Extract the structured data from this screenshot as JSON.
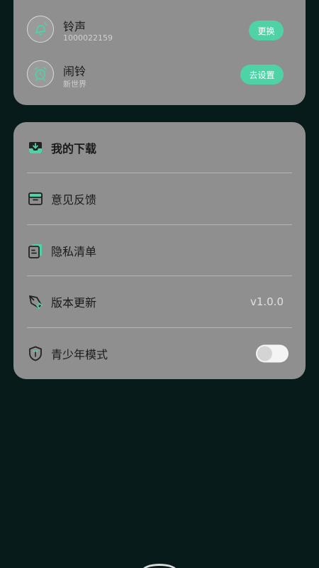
{
  "ringtones": [
    {
      "title": "铃声",
      "subtitle": "1000022159",
      "action": "更换",
      "icon": "bell-icon"
    },
    {
      "title": "闹铃",
      "subtitle": "新世界",
      "action": "去设置",
      "icon": "alarm-clock-icon"
    }
  ],
  "menu": [
    {
      "label": "我的下载",
      "icon": "download-inbox-icon"
    },
    {
      "label": "意见反馈",
      "icon": "feedback-box-icon"
    },
    {
      "label": "隐私清单",
      "icon": "document-list-icon"
    },
    {
      "label": "版本更新",
      "icon": "rocket-icon",
      "value": "v1.0.0"
    },
    {
      "label": "青少年模式",
      "icon": "youth-shield-icon",
      "toggle_on": false
    }
  ],
  "colors": {
    "accent": "#4fd3a6",
    "background": "#061b1a",
    "card": "#8f8f8f"
  }
}
